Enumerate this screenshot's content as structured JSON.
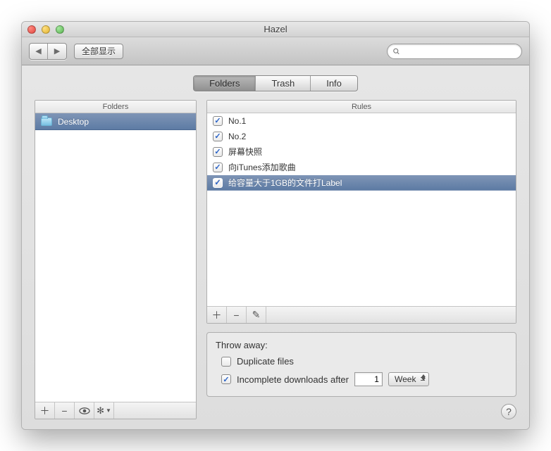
{
  "window": {
    "title": "Hazel"
  },
  "toolbar": {
    "show_all_label": "全部显示",
    "search_placeholder": ""
  },
  "tabs": [
    {
      "label": "Folders",
      "active": true
    },
    {
      "label": "Trash",
      "active": false
    },
    {
      "label": "Info",
      "active": false
    }
  ],
  "folders": {
    "header": "Folders",
    "items": [
      {
        "name": "Desktop",
        "selected": true
      }
    ]
  },
  "rules": {
    "header": "Rules",
    "items": [
      {
        "name": "No.1",
        "checked": true,
        "selected": false
      },
      {
        "name": "No.2",
        "checked": true,
        "selected": false
      },
      {
        "name": "屏幕快照",
        "checked": true,
        "selected": false
      },
      {
        "name": "向iTunes添加歌曲",
        "checked": true,
        "selected": false
      },
      {
        "name": "给容量大于1GB的文件打Label",
        "checked": true,
        "selected": true
      }
    ]
  },
  "throw_away": {
    "title": "Throw away:",
    "duplicate_label": "Duplicate files",
    "duplicate_checked": false,
    "incomplete_label": "Incomplete downloads after",
    "incomplete_checked": true,
    "incomplete_value": "1",
    "incomplete_unit": "Week"
  },
  "icons": {
    "plus": "+",
    "minus": "−",
    "pencil": "✎",
    "gear": "⚙",
    "eye": "👁",
    "help": "?",
    "search": "search",
    "chevron_down": "▾"
  }
}
